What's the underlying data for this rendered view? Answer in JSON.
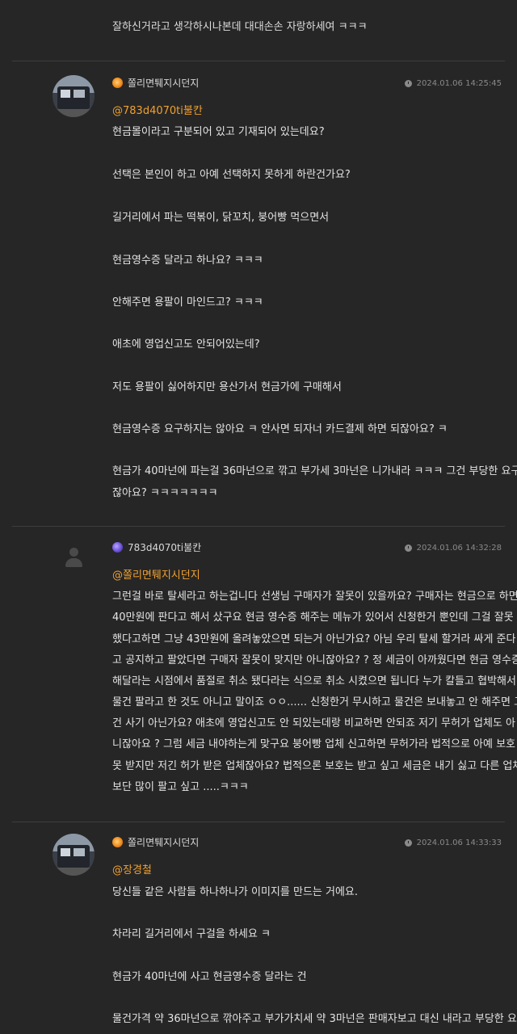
{
  "top_text": "잘하신거라고 생각하시나본데 대대손손 자랑하세여 ㅋㅋㅋ",
  "comments": [
    {
      "user": "쫄리면퉤지시던지",
      "badge_icon": "sun-badge-icon",
      "time": "2024.01.06 14:25:45",
      "mention": "@783d4070ti불칸",
      "lines": [
        "현금몰이라고 구분되어 있고 기재되어 있는데요?",
        "선택은 본인이 하고 아예 선택하지 못하게 하란건가요?",
        "길거리에서 파는 떡볶이, 닭꼬치, 붕어빵 먹으면서",
        "현금영수증 달라고 하나요? ㅋㅋㅋ",
        "안해주면 용팔이 마인드고? ㅋㅋㅋ",
        "애초에 영업신고도 안되어있는데?",
        "저도 용팔이 싫어하지만 용산가서 현금가에 구매해서",
        "현금영수증 요구하지는 않아요 ㅋ 안사면 되자너 카드결제 하면 되잖아요? ㅋ",
        "현금가 40마넌에 파는걸 36마넌으로 깎고 부가세 3마넌은 니가내라 ㅋㅋㅋ 그건 부당한 요구",
        "잖아요? ㅋㅋㅋㅋㅋㅋㅋ"
      ]
    },
    {
      "user": "783d4070ti불칸",
      "badge_icon": "planet-badge-icon",
      "time": "2024.01.06 14:32:28",
      "mention": "@쫄리면퉤지시던지",
      "lines": [
        "그런걸 바로 탈세라고 하는겁니다 선생님 구매자가 잘못이 있을까요? 구매자는 현금으로 하면",
        "40만원에 판다고 해서 샀구요 현금 영수증 해주는 메뉴가 있어서 신청한거 뿐인데 그걸 잘못",
        "했다고하면 그냥 43만원에 올려놓았으면 되는거 아닌가요? 아님 우리 탈세 할거라 싸게 준다",
        "고 공지하고 팔았다면 구매자 잘못이 맞지만 아니잖아요? ? 정 세금이 아까웠다면 현금 영수증",
        "해달라는 시점에서 품절로 취소 됐다라는 식으로 취소 시켰으면 됩니다 누가 칼들고 협박해서",
        "물건 팔라고 한 것도 아니고 말이죠 ㅇㅇ...... 신청한거 무시하고 물건은 보내놓고 안 해주면 그",
        "건 사기 아닌가요? 애초에 영업신고도 안 되있는데랑 비교하면 안되죠 저기 무허가 업체도 아",
        "니잖아요 ? 그럼 세금 내야하는게 맞구요 붕어빵 업체 신고하면 무허가라 법적으로 아예 보호",
        "못 받지만 저긴 허가 받은 업체잖아요? 법적으론 보호는 받고 싶고 세금은 내기 싫고 다른 업체",
        "보단 많이 팔고 싶고 .....ㅋㅋㅋ"
      ]
    },
    {
      "user": "쫄리면퉤지시던지",
      "badge_icon": "sun-badge-icon",
      "time": "2024.01.06 14:33:33",
      "mention": "@장경철",
      "lines": [
        "당신들 같은 사람들 하나하나가 이미지를 만드는 거에요.",
        "차라리 길거리에서 구걸을 하세요 ㅋ",
        "현금가 40마넌에 사고 현금영수증 달라는 건",
        "물건가격 약 36마넌으로 깎아주고 부가가치세 약 3마넌은 판매자보고 대신 내라고 부당한 요"
      ]
    }
  ]
}
